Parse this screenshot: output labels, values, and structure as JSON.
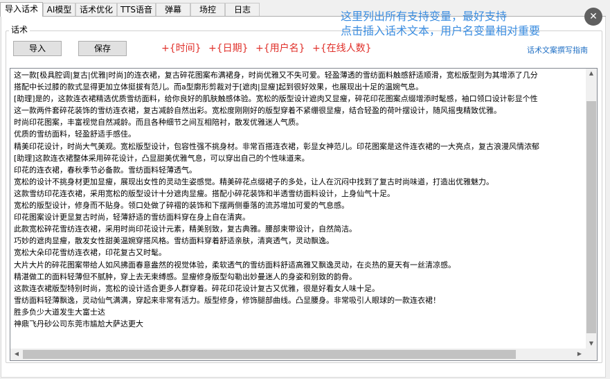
{
  "tabs": [
    "导入话术",
    "AI模型",
    "话术优化",
    "TTS语音",
    "弹幕",
    "场控",
    "日志"
  ],
  "group_title": "话术",
  "buttons": {
    "import": "导入",
    "save": "保存"
  },
  "variables": [
    "+{时间}",
    "+{日期}",
    "+{用户名}",
    "+{在线人数}"
  ],
  "hint_lines": [
    "这里列出所有支持变量，最好支持",
    "点击插入话术文本，用户名变量相对重要"
  ],
  "guide_link": "话术文案撰写指南",
  "close_icon": "close-icon",
  "script_lines": [
    "这一款[极具腔调|复古|优雅|时尚]的连衣裙，复古碎花图案布满裙身，时尚优雅又不失可爱。轻盈薄透的雪纺面料触感舒适顺滑，宽松版型则为其增添了几分",
    "搭配中长过膝的款式显得更加立体挺拔有范儿。而a型廓形剪裁对于[遮肉|显瘦]起到很好效果，也展现出十足的温婉气息。",
    "[助理]是的，这款连衣裙精选优质雪纺面料，给你良好的肌肤触感体验。宽松的版型设计遮肉又显瘦，碎花印花图案点缀增添时髦感，袖口领口设计彰显个性",
    "这一款两件套碎花装饰的雪纺连衣裙，复古减龄自然出彩。宽松度刚刚好的版型穿着不紧绷很显瘦，结合轻盈的荷叶摆设计，随风摇曳精致优雅。",
    "时尚印花图案，丰富视觉自然减龄。而且各种细节之间互相陪衬，散发优雅迷人气质。",
    "优质的雪纺面料，轻盈舒适手感佳。",
    "精美印花设计，时尚大气美观。宽松版型设计，包容性强不挑身材。非常百搭连衣裙，彰显女神范儿。印花图案是这件连衣裙的一大亮点，复古浪漫风情浓郁",
    "[助理]这款连衣裙整体采用碎花设计，凸显甜美优雅气息，可以穿出自己的个性味道来。",
    "印花的连衣裙，春秋季节必备款。雪纺面料轻薄透气。",
    "宽松的设计不挑身材更加显瘦，展现出女性的灵动生姿感觉。精美碎花点缀裙子的多处，让人在沉闷中找到了复古时尚味道，打造出优雅魅力。",
    "这款雪纺印花连衣裙，采用宽松的版型设计十分遮肉显瘦。搭配小碎花装饰和半透雪纺面料设计，上身仙气十足。",
    "宽松的版型设计，修身而不贴身。领口处做了碎褶的装饰和下摆两侧垂落的流苏增加可爱的气息感。",
    "印花图案设计更显复古时尚，轻薄舒适的雪纺面料穿在身上自在清爽。",
    "此款宽松碎花雪纺连衣裙，采用时尚印花设计元素，精美别致，复古典雅。腰部束带设计，自然简洁。",
    "巧妙的遮肉显瘦，散发女性甜美温婉穿搭风格。雪纺面料穿着舒适亲肤，清爽透气，灵动飘逸。",
    "宽松大朵印花雪纺连衣裙，印花复古又时髦。",
    "大片大片的碎花图案带给人如风拂面春意盎然的视觉体验，柔软透气的雪纺面料舒适高雅又飘逸灵动，在炎热的夏天有一丝清凉感。",
    "精湛做工的面料轻薄但不腻肿，穿上去无束缚感。显瘦修身版型勾勒出妙曼迷人的身姿和别致的韵骨。",
    "这款连衣裙版型特别时尚，宽松的设计适合更多人群穿着。碎花印花设计复古又优雅，很是好看女人味十足。",
    "雪纺面料轻薄飘逸，灵动仙气满满，穿起来非常有活力。版型修身，修饰腿部曲线。凸显腰身。非常吸引人眼球的一款连衣裙！",
    "胜多负少大道发生大富士达",
    "神鼎飞丹砂公司东莞市尴尬大萨达更大"
  ]
}
